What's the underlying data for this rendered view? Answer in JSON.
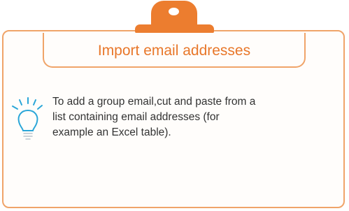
{
  "title": "Import email addresses",
  "tip": {
    "icon": "lightbulb-icon",
    "text": "To add a group email,cut and paste from a list containing email addresses (for example an Excel table)."
  },
  "colors": {
    "accent": "#ec7d2f",
    "border": "#f0a469",
    "bulb": "#2aa6d8"
  }
}
